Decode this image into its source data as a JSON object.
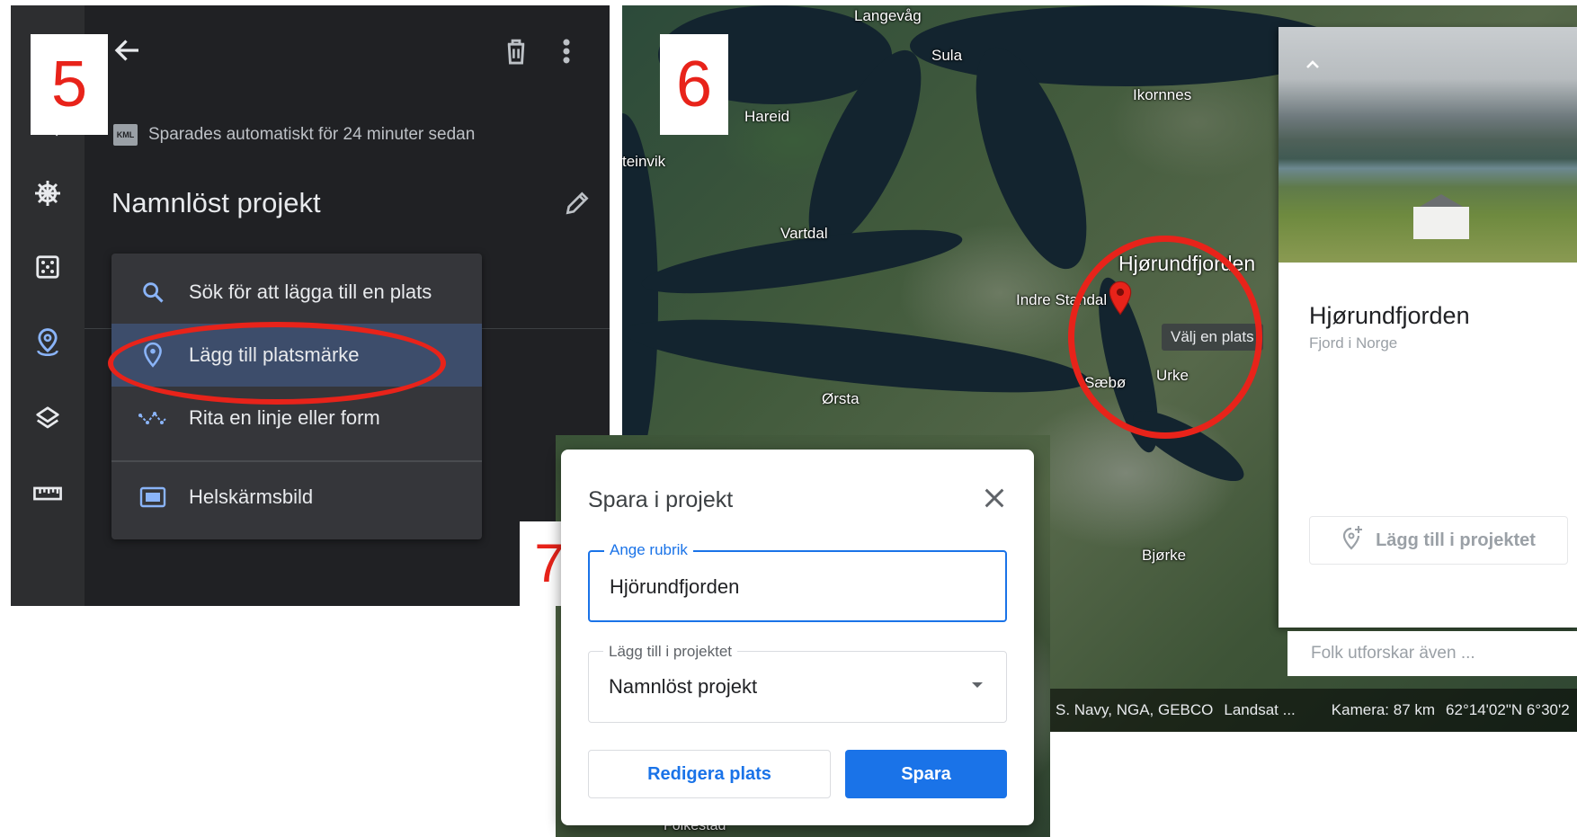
{
  "step_numbers": {
    "panel5": "5",
    "panel6": "6",
    "panel7": "7"
  },
  "panel5": {
    "autosave_badge": "KML",
    "autosave_text": "Sparades automatiskt för 24 minuter sedan",
    "project_title": "Namnlöst projekt",
    "menu": [
      {
        "label": "Sök för att lägga till en plats",
        "icon": "search-icon"
      },
      {
        "label": "Lägg till platsmärke",
        "icon": "location-pin-icon",
        "highlighted": true
      },
      {
        "label": "Rita en linje eller form",
        "icon": "line-shape-icon"
      },
      {
        "label": "Helskärmsbild",
        "icon": "fullscreen-icon"
      }
    ],
    "rail_icons": [
      "search-icon",
      "voyager-wheel-icon",
      "dice-icon",
      "projects-pin-icon",
      "layers-icon",
      "ruler-icon"
    ]
  },
  "panel6": {
    "places": [
      "Langevåg",
      "Sula",
      "Hareid",
      "Ikornnes",
      "teinvik",
      "Vartdal",
      "Hjørundfjorden",
      "Indre Standal",
      "Ørsta",
      "Sæbø",
      "Urke",
      "Bjørke"
    ],
    "tooltip": "Välj en plats",
    "card": {
      "title": "Hjørundfjorden",
      "subtitle": "Fjord i Norge",
      "add_button": "Lägg till i projektet",
      "explore": "Folk utforskar även ..."
    },
    "attribution": {
      "sources": "S. Navy, NGA, GEBCO",
      "landsat": "Landsat ...",
      "camera": "Kamera: 87 km",
      "coords": "62°14'02\"N 6°30'2"
    }
  },
  "panel7": {
    "title": "Spara i projekt",
    "title_field": {
      "label": "Ange rubrik",
      "value": "Hjörundfjorden"
    },
    "project_field": {
      "label": "Lägg till i projektet",
      "value": "Namnlöst projekt"
    },
    "edit_button": "Redigera plats",
    "save_button": "Spara",
    "map_label": "Folkestad"
  },
  "colors": {
    "accent_blue": "#1a73e8",
    "annotation_red": "#e8231a",
    "dark_bg": "#202124"
  }
}
